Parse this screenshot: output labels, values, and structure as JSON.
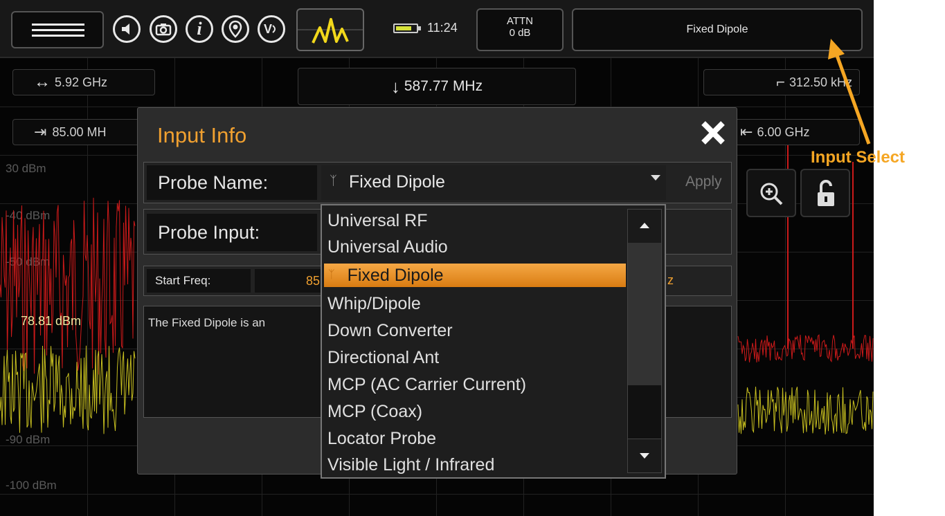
{
  "topbar": {
    "icons": [
      "menu-icon",
      "speaker-icon",
      "camera-icon",
      "info-icon",
      "location-icon",
      "voice-icon",
      "spectrum-icon",
      "battery-icon"
    ],
    "time": "11:24",
    "attn_label": "ATTN",
    "attn_value": "0 dB",
    "input_select_value": "Fixed Dipole",
    "voice_icon_text": "V",
    "info_icon_text": "i"
  },
  "plot": {
    "span": "5.92 GHz",
    "center": "587.77 MHz",
    "rbw": "312.50 kHz",
    "start": "85.00 MH",
    "stop": "6.00 GHz",
    "marker_value": "78.81 dBm",
    "y_labels": [
      "30 dBm",
      "-40 dBm",
      "-50 dBm",
      "-90 dBm",
      "-100 dBm"
    ]
  },
  "dialog": {
    "title": "Input Info",
    "probe_name_label": "Probe Name:",
    "probe_name_value": "Fixed Dipole",
    "apply_label": "Apply",
    "probe_input_label": "Probe Input:",
    "start_freq_label": "Start Freq:",
    "start_freq_value": "85",
    "right_partial": "z",
    "description": "The Fixed Dipole is an"
  },
  "dropdown": {
    "items": [
      "Universal RF",
      "Universal Audio",
      "Fixed Dipole",
      "Whip/Dipole",
      "Down Converter",
      "Directional Ant",
      "MCP (AC Carrier Current)",
      "MCP (Coax)",
      "Locator Probe",
      "Visible Light / Infrared"
    ],
    "selected_index": 2
  },
  "annotation": {
    "word1": "Input",
    "word2": "Select",
    "color": "#f5a623"
  },
  "colors": {
    "accent": "#f0a030",
    "trace_max": "#cc1a1a",
    "trace_live": "#c8c020"
  }
}
